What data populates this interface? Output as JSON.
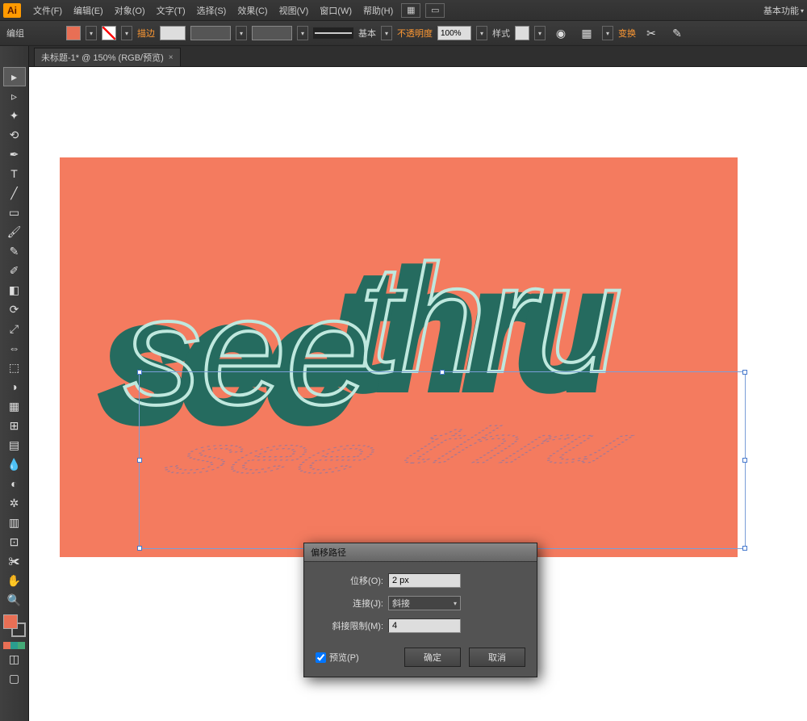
{
  "app": {
    "logo": "Ai"
  },
  "menu": {
    "items": [
      "文件(F)",
      "编辑(E)",
      "对象(O)",
      "文字(T)",
      "选择(S)",
      "效果(C)",
      "视图(V)",
      "窗口(W)",
      "帮助(H)"
    ],
    "workspace": "基本功能"
  },
  "control": {
    "mode": "编组",
    "fill_color": "#e86f55",
    "stroke_label": "描边",
    "stroke_width": "",
    "stroke_style": "基本",
    "opacity_label": "不透明度",
    "opacity_value": "100%",
    "style_label": "样式",
    "transform_label": "变换"
  },
  "tab": {
    "title": "未标题-1* @ 150% (RGB/预览)"
  },
  "artwork": {
    "word1": "see",
    "word2": "thru"
  },
  "dialog": {
    "title": "偏移路径",
    "offset_label": "位移(O):",
    "offset_value": "2 px",
    "join_label": "连接(J):",
    "join_value": "斜接",
    "miter_label": "斜接限制(M):",
    "miter_value": "4",
    "preview_label": "预览(P)",
    "ok": "确定",
    "cancel": "取消"
  }
}
